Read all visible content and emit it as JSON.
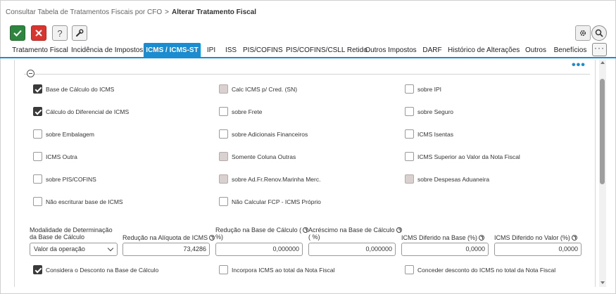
{
  "breadcrumb": {
    "parent": "Consultar Tabela de Tratamentos Fiscais por CFO",
    "separator": ">",
    "current": "Alterar Tratamento Fiscal"
  },
  "toolbar": {
    "help_label": "?"
  },
  "tabs": [
    {
      "label": "Tratamento Fiscal"
    },
    {
      "label": "Incidência de Impostos"
    },
    {
      "label": "ICMS / ICMS-ST",
      "active": true
    },
    {
      "label": "IPI"
    },
    {
      "label": "ISS"
    },
    {
      "label": "PIS/COFINS"
    },
    {
      "label": "PIS/COFINS/CSLL Retido"
    },
    {
      "label": "Outros Impostos"
    },
    {
      "label": "DARF"
    },
    {
      "label": "Histórico de Alterações"
    },
    {
      "label": "Outros"
    },
    {
      "label": "Benefícios"
    }
  ],
  "tab_more_label": "···",
  "panel_more_label": "•••",
  "checkboxes": [
    {
      "label": "Base de Cálculo do ICMS",
      "checked": true
    },
    {
      "label": "Calc ICMS p/ Cred. (SN)",
      "checked": false,
      "disabled": true
    },
    {
      "label": "sobre IPI",
      "checked": false
    },
    {
      "label": "Cálculo do Diferencial de ICMS",
      "checked": true
    },
    {
      "label": "sobre Frete",
      "checked": false
    },
    {
      "label": "sobre Seguro",
      "checked": false
    },
    {
      "label": "sobre Embalagem",
      "checked": false
    },
    {
      "label": "sobre Adicionais Financeiros",
      "checked": false
    },
    {
      "label": "ICMS Isentas",
      "checked": false
    },
    {
      "label": "ICMS Outra",
      "checked": false
    },
    {
      "label": "Somente Coluna Outras",
      "checked": false,
      "disabled": true
    },
    {
      "label": "ICMS Superior ao Valor da Nota Fiscal",
      "checked": false
    },
    {
      "label": "sobre PIS/COFINS",
      "checked": false
    },
    {
      "label": "sobre Ad.Fr.Renov.Marinha Merc.",
      "checked": false,
      "disabled": true
    },
    {
      "label": "sobre Despesas Aduaneira",
      "checked": false,
      "disabled": true
    },
    {
      "label": "Não escriturar base de ICMS",
      "checked": false
    },
    {
      "label": "Não Calcular FCP - ICMS Próprio",
      "checked": false
    }
  ],
  "fields": {
    "modalidade": {
      "label_line1": "Modalidade de Determinação",
      "label_line2": "da Base de Cálculo",
      "value": "Valor da operação"
    },
    "reducao_aliquota": {
      "label": "Redução na Alíquota de ICMS",
      "value": "73,4286"
    },
    "reducao_base": {
      "label_line1": "Redução na Base de Cálculo (",
      "label_line2": "%)",
      "value": "0,000000"
    },
    "acrescimo_base": {
      "label_line1": "Acréscimo na Base de Cálculo",
      "label_line2": "( %)",
      "value": "0,000000"
    },
    "icms_diferido_base": {
      "label": "ICMS Diferido na Base (%)",
      "value": "0,0000"
    },
    "icms_diferido_valor": {
      "label": "ICMS Diferido no Valor (%)",
      "value": "0,0000"
    }
  },
  "bottom_checkboxes": [
    {
      "label": "Considera o Desconto na Base de Cálculo",
      "checked": true
    },
    {
      "label": "Incorpora ICMS ao total da Nota Fiscal",
      "checked": false
    },
    {
      "label": "Conceder desconto do ICMS no total da Nota Fiscal",
      "checked": false
    }
  ]
}
